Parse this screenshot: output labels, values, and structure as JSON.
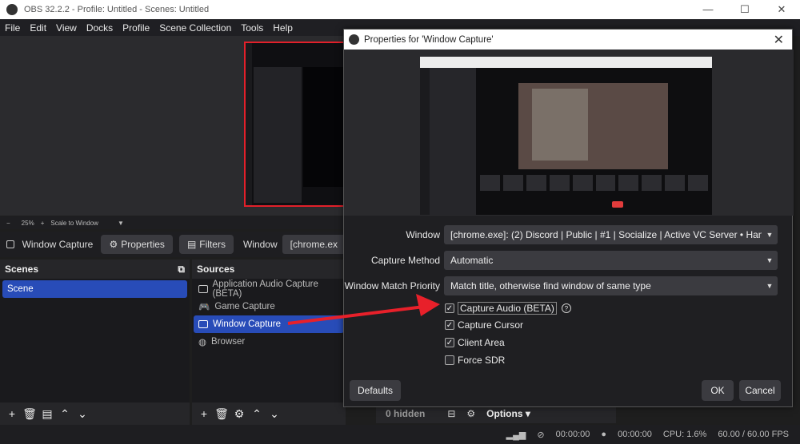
{
  "window": {
    "title": "OBS 32.2.2 - Profile: Untitled - Scenes: Untitled",
    "minimize": "—",
    "maximize": "☐",
    "close": "✕"
  },
  "menu": [
    "File",
    "Edit",
    "View",
    "Docks",
    "Profile",
    "Scene Collection",
    "Tools",
    "Help"
  ],
  "zoom": {
    "minus": "−",
    "level": "25%",
    "plus": "+",
    "mode": "Scale to Window"
  },
  "source_toolbar": {
    "selected": "Window Capture",
    "properties": "Properties",
    "filters": "Filters",
    "window_label": "Window",
    "window_value": "[chrome.ex"
  },
  "scenes": {
    "header": "Scenes",
    "items": [
      "Scene"
    ]
  },
  "sources": {
    "header": "Sources",
    "items": [
      "Application Audio Capture (BETA)",
      "Game Capture",
      "Window Capture",
      "Browser"
    ]
  },
  "mixer": {
    "hidden": "0 hidden",
    "options": "Options"
  },
  "status": {
    "rec": "00:00:00",
    "stream": "00:00:00",
    "cpu": "CPU: 1.6%",
    "fps": "60.00 / 60.00 FPS"
  },
  "dialog": {
    "title": "Properties for 'Window Capture'",
    "window_label": "Window",
    "window_value": "[chrome.exe]: (2) Discord | Public | #1 | Socialize | Active VC Server • Hangout • Voic",
    "method_label": "Capture Method",
    "method_value": "Automatic",
    "priority_label": "Window Match Priority",
    "priority_value": "Match title, otherwise find window of same type",
    "checks": [
      {
        "label": "Capture Audio (BETA)",
        "checked": true
      },
      {
        "label": "Capture Cursor",
        "checked": true
      },
      {
        "label": "Client Area",
        "checked": true
      },
      {
        "label": "Force SDR",
        "checked": false
      }
    ],
    "defaults": "Defaults",
    "ok": "OK",
    "cancel": "Cancel"
  },
  "colors": {
    "accent": "#284cb8",
    "arrow": "#e8202a"
  }
}
